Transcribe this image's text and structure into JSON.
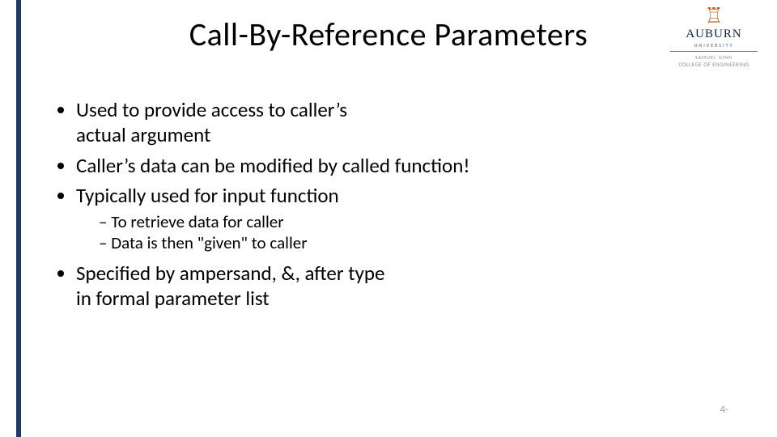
{
  "title": "Call-By-Reference Parameters",
  "logo": {
    "university": "AUBURN",
    "sub1": "UNIVERSITY",
    "coe_pre": "SAMUEL GINN",
    "coe": "COLLEGE OF ENGINEERING"
  },
  "bullets": {
    "b1a": "Used to provide access to caller’s",
    "b1b": "actual argument",
    "b2": "Caller’s data can be modified by called function!",
    "b3": "Typically used for input function",
    "b3s1": "To retrieve data for caller",
    "b3s2": "Data is then \"given\" to caller",
    "b4a": "Specified by ampersand, &, after type",
    "b4b": "in formal parameter list"
  },
  "pagenum": "4-"
}
